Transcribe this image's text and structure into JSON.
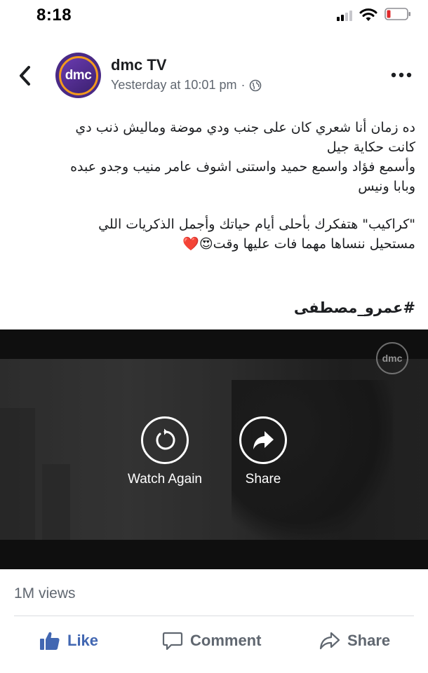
{
  "status_bar": {
    "time": "8:18",
    "icons": [
      "signal-icon",
      "wifi-icon",
      "battery-icon"
    ]
  },
  "header": {
    "page_name": "dmc TV",
    "timestamp": "Yesterday at 10:01 pm",
    "separator": "·",
    "avatar_text": "dmc",
    "privacy_icon": "globe-icon"
  },
  "post": {
    "lines": [
      "ده زمان أنا شعري كان على جنب ودي موضة وماليش ذنب دي",
      "كانت حكاية جيل",
      "وأسمع فؤاد واسمع حميد واستنى اشوف عامر منيب وجدو عبده",
      "وبابا ونيس",
      "",
      "\"كراكيب\" هتفكرك بأحلى أيام حياتك وأجمل الذكريات اللي",
      "مستحيل ننساها مهما فات عليها وقت😍❤️"
    ],
    "hashtag": "#عمرو_مصطفى"
  },
  "video": {
    "watermark": "dmc",
    "watch_again_label": "Watch Again",
    "share_label": "Share"
  },
  "footer": {
    "views": "1M views",
    "like_label": "Like",
    "comment_label": "Comment",
    "share_label": "Share"
  },
  "colors": {
    "facebook_blue": "#4267b2",
    "secondary_text": "#606770",
    "brand_purple": "#4a2a86",
    "brand_orange": "#f39a1d",
    "battery_low": "#e0292b"
  }
}
